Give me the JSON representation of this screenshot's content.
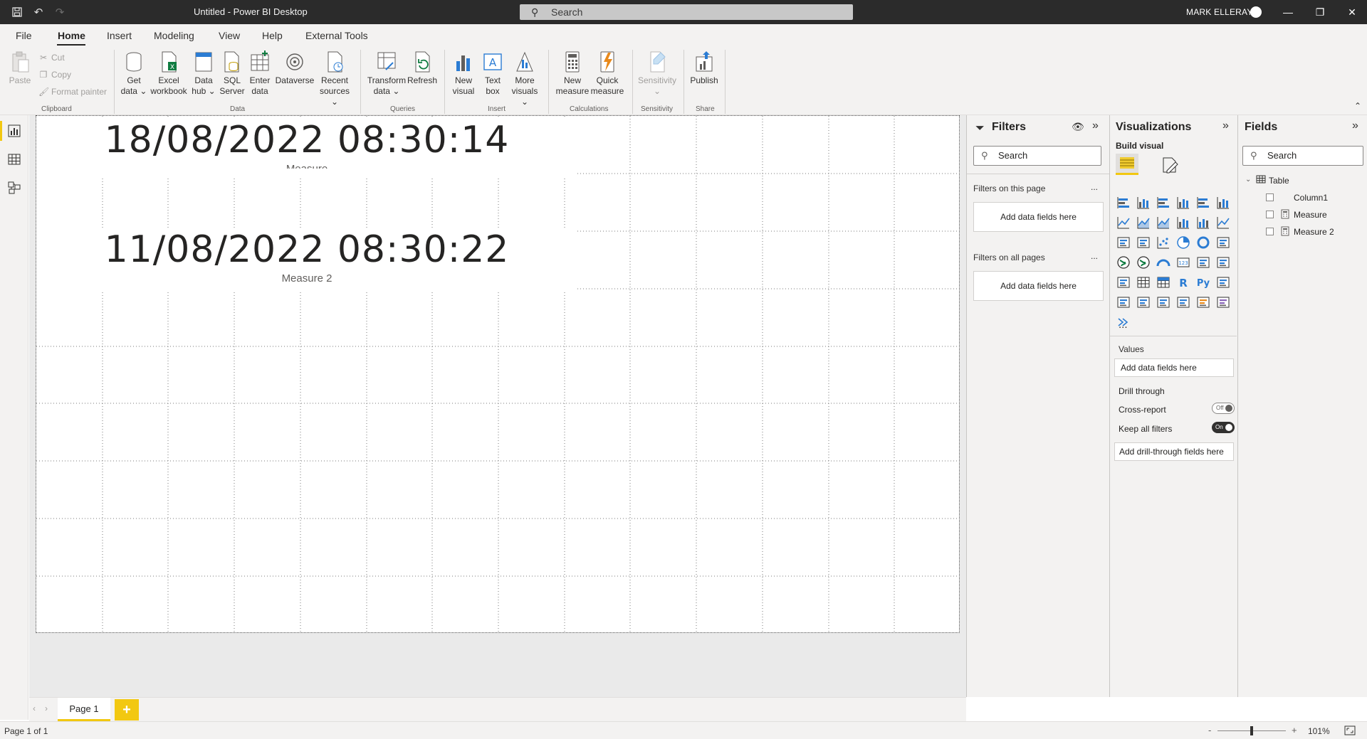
{
  "titlebar": {
    "title": "Untitled - Power BI Desktop",
    "search_placeholder": "Search",
    "user": "MARK ELLERAY"
  },
  "menu": {
    "tabs": [
      "File",
      "Home",
      "Insert",
      "Modeling",
      "View",
      "Help",
      "External Tools"
    ],
    "active": "Home"
  },
  "ribbon": {
    "clipboard": {
      "paste": "Paste",
      "cut": "Cut",
      "copy": "Copy",
      "format_painter": "Format painter",
      "label": "Clipboard"
    },
    "data": {
      "get_data": [
        "Get",
        "data"
      ],
      "excel": [
        "Excel",
        "workbook"
      ],
      "data_hub": [
        "Data",
        "hub"
      ],
      "sql": [
        "SQL",
        "Server"
      ],
      "enter": [
        "Enter",
        "data"
      ],
      "dataverse": [
        "Dataverse"
      ],
      "recent": [
        "Recent",
        "sources"
      ],
      "label": "Data"
    },
    "queries": {
      "transform": [
        "Transform",
        "data"
      ],
      "refresh": [
        "Refresh"
      ],
      "label": "Queries"
    },
    "insert": {
      "new_visual": [
        "New",
        "visual"
      ],
      "text_box": [
        "Text",
        "box"
      ],
      "more_visuals": [
        "More",
        "visuals"
      ],
      "label": "Insert"
    },
    "calculations": {
      "new_measure": [
        "New",
        "measure"
      ],
      "quick_measure": [
        "Quick",
        "measure"
      ],
      "label": "Calculations"
    },
    "sensitivity": {
      "btn": [
        "Sensitivity"
      ],
      "label": "Sensitivity"
    },
    "share": {
      "publish": [
        "Publish"
      ],
      "label": "Share"
    }
  },
  "canvas": {
    "cards": [
      {
        "value": "18/08/2022 08:30:14",
        "label": "Measure"
      },
      {
        "value": "11/08/2022 08:30:22",
        "label": "Measure 2"
      }
    ]
  },
  "filters": {
    "title": "Filters",
    "search_placeholder": "Search",
    "on_this_page": "Filters on this page",
    "on_all_pages": "Filters on all pages",
    "add_fields": "Add data fields here",
    "more": "..."
  },
  "visualizations": {
    "title": "Visualizations",
    "build_visual": "Build visual",
    "values_label": "Values",
    "values_add": "Add data fields here",
    "drill_through": "Drill through",
    "cross_report": "Cross-report",
    "cross_report_state": "Off",
    "keep_all_filters": "Keep all filters",
    "keep_all_filters_state": "On",
    "drill_add": "Add drill-through fields here",
    "more_visuals": "..."
  },
  "fields": {
    "title": "Fields",
    "search_placeholder": "Search",
    "table": "Table",
    "items": [
      "Column1",
      "Measure",
      "Measure 2"
    ]
  },
  "pages": {
    "tabs": [
      "Page 1"
    ],
    "add": "+"
  },
  "status": {
    "page_info": "Page 1 of 1",
    "zoom": "101%",
    "zoom_minus": "-",
    "zoom_plus": "+"
  },
  "colors": {
    "accent": "#f2c811",
    "titlebar": "#2b2b2b",
    "ribbon": "#f3f2f1",
    "icon_blue": "#2b7cd3",
    "icon_green": "#107c41"
  }
}
